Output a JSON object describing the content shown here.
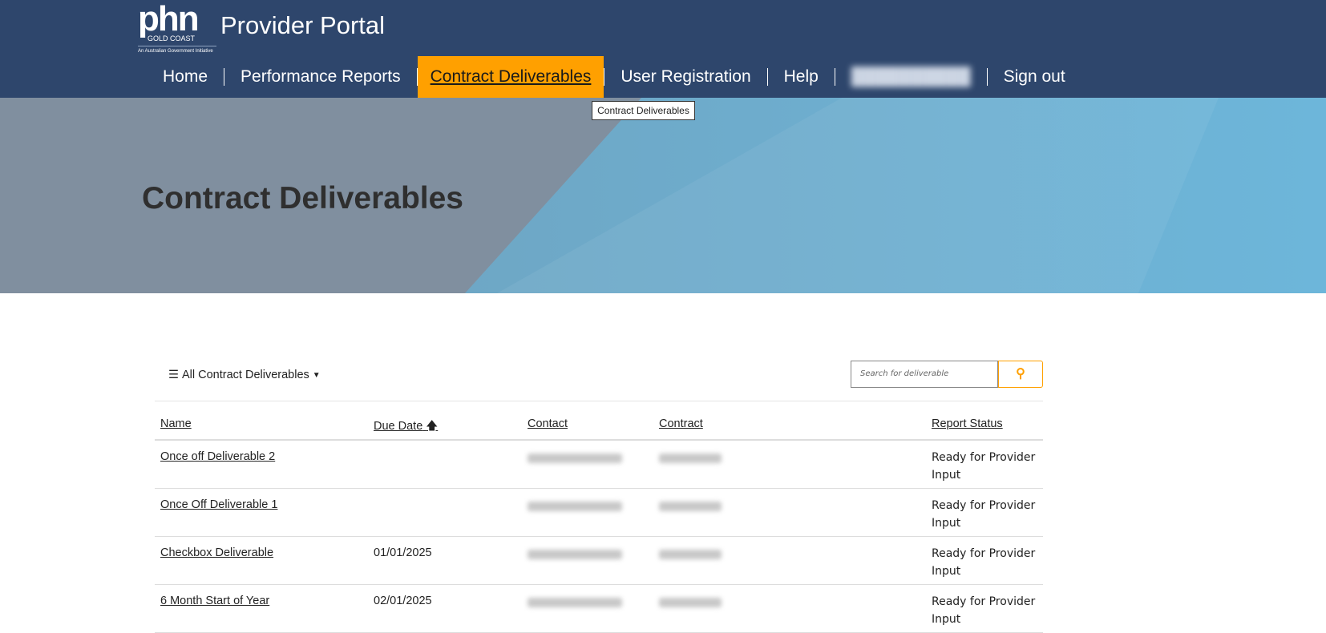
{
  "header": {
    "logo": {
      "main": "phn",
      "sub": "GOLD COAST",
      "tagline": "An Australian Government Initiative"
    },
    "portal_title": "Provider Portal"
  },
  "nav": {
    "items": [
      "Home",
      "Performance Reports",
      "Contract Deliverables",
      "User Registration",
      "Help"
    ],
    "sign_out": "Sign out",
    "active": "Contract Deliverables"
  },
  "tooltip": "Contract Deliverables",
  "page_title": "Contract Deliverables",
  "toolbar": {
    "filter_label": "All Contract Deliverables",
    "search_placeholder": "Search for deliverable"
  },
  "table": {
    "headers": [
      "Name",
      "Due Date",
      "Contact",
      "Contract",
      "Report Status"
    ],
    "rows": [
      {
        "name": "Once off Deliverable 2",
        "due": "",
        "status": "Ready for Provider Input"
      },
      {
        "name": "Once Off Deliverable 1",
        "due": "",
        "status": "Ready for Provider Input"
      },
      {
        "name": "Checkbox Deliverable",
        "due": "01/01/2025",
        "status": "Ready for Provider Input"
      },
      {
        "name": "6 Month Start of Year",
        "due": "02/01/2025",
        "status": "Ready for Provider Input"
      }
    ]
  },
  "colors": {
    "header": "#2e466c",
    "accent": "#ffa000"
  }
}
